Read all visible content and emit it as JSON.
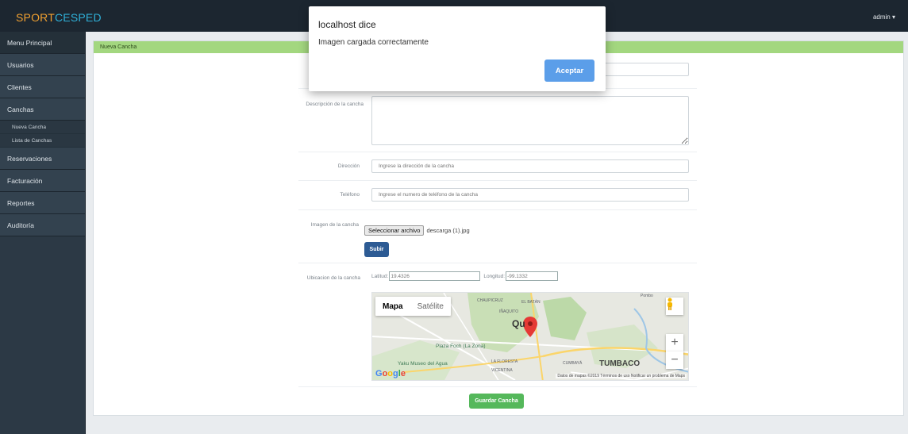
{
  "navbar": {
    "brand_part1": "SPORT",
    "brand_part2": "CESPED",
    "user": "admin ▾"
  },
  "sidebar": {
    "items": [
      {
        "label": "Menu Principal"
      },
      {
        "label": "Usuarios"
      },
      {
        "label": "Clientes"
      },
      {
        "label": "Canchas"
      },
      {
        "label": "Reservaciones"
      },
      {
        "label": "Facturación"
      },
      {
        "label": "Reportes"
      },
      {
        "label": "Auditoría"
      }
    ],
    "sub_items": [
      {
        "label": "Nueva Cancha"
      },
      {
        "label": "Lista de Canchas"
      }
    ]
  },
  "panel": {
    "header": "Nueva Cancha"
  },
  "form": {
    "descripcion_label": "Descripción de la cancha",
    "direccion_label": "Dirección",
    "direccion_placeholder": "Ingrese la dirección de la cancha",
    "telefono_label": "Teléfono",
    "telefono_placeholder": "Ingrese el numero de teléfono de la cancha",
    "imagen_label": "Imagen de la cancha",
    "file_button": "Seleccionar archivo",
    "file_name": "descarga (1).jpg",
    "upload_button": "Subir",
    "ubicacion_label": "Ubicacion de la cancha",
    "latitud_label": "Latitud:",
    "latitud_value": "19.4326",
    "longitud_label": "Longitud:",
    "longitud_value": "-99.1332",
    "save_button": "Guardar Cancha"
  },
  "map": {
    "type_map": "Mapa",
    "type_satellite": "Satélite",
    "labels": {
      "chaupicruz": "CHAUPICRUZ",
      "el_batan": "EL BATÁN",
      "inaquito": "IÑAQUITO",
      "city": "Qu",
      "plaza": "Plaza Foch (La Zona)",
      "yaku": "Yaku Museo del Agua",
      "floresta": "LA FLORESTA",
      "vicentina": "VICENTINA",
      "cumbaya": "CUMBAYÁ",
      "tumbaco": "TUMBACO",
      "pomasqui": "Pombo"
    },
    "zoom_in": "+",
    "zoom_out": "−",
    "google": "Google",
    "attribution": "Datos de mapas ©2019  Términos de uso  Notificar un problema de Maps"
  },
  "dialog": {
    "title": "localhost dice",
    "message": "Imagen cargada correctamente",
    "ok_button": "Aceptar"
  }
}
